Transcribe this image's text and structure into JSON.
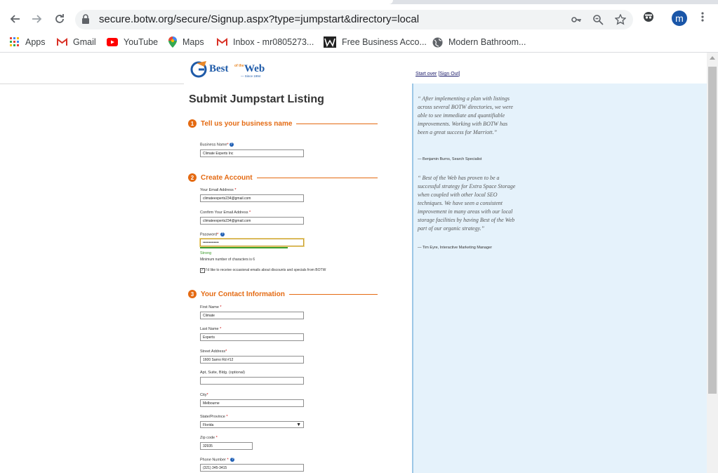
{
  "browser": {
    "url": "secure.botw.org/secure/Signup.aspx?type=jumpstart&directory=local",
    "avatar_letter": "m",
    "bookmarks": [
      {
        "label": "Apps",
        "icon": "apps-grid-icon"
      },
      {
        "label": "Gmail",
        "icon": "gmail-icon"
      },
      {
        "label": "YouTube",
        "icon": "youtube-icon"
      },
      {
        "label": "Maps",
        "icon": "maps-pin-icon"
      },
      {
        "label": "Inbox - mr0805273...",
        "icon": "gmail-icon"
      },
      {
        "label": "Free Business Acco...",
        "icon": "w-logo-icon"
      },
      {
        "label": "Modern Bathroom...",
        "icon": "globe-icon"
      }
    ]
  },
  "header": {
    "logo_text": "Best Web",
    "logo_small": "of the",
    "logo_since": "— Since 1994",
    "start_over": "Start over",
    "sign_out": "Sign Out"
  },
  "form": {
    "title": "Submit Jumpstart Listing",
    "sections": [
      {
        "num": "1",
        "title": "Tell us your business name"
      },
      {
        "num": "2",
        "title": "Create Account"
      },
      {
        "num": "3",
        "title": "Your Contact Information"
      }
    ],
    "business_name": {
      "label": "Business Name",
      "value": "Climate Experts Inc"
    },
    "email": {
      "label": "Your Email Address",
      "value": "climateexperts234@gmail.com"
    },
    "confirm_email": {
      "label": "Confirm Your Email Address",
      "value": "climateexperts234@gmail.com"
    },
    "password": {
      "label": "Password",
      "value": "•••••••••••••",
      "strength": "Strong",
      "hint": "Minimum number of characters is 6"
    },
    "newsletter": {
      "label": "I'd like to receive occasional emails about discounts and specials from BOTW",
      "checked": "✓"
    },
    "first_name": {
      "label": "First Name",
      "value": "Climate"
    },
    "last_name": {
      "label": "Last Name",
      "value": "Experts"
    },
    "street": {
      "label": "Street Address",
      "value": "1600 Sarno Rd #12"
    },
    "apt": {
      "label": "Apt, Suite, Bldg. (optional)",
      "value": ""
    },
    "city": {
      "label": "City",
      "value": "Melbourne"
    },
    "state": {
      "label": "State/Province",
      "value": "Florida"
    },
    "zip": {
      "label": "Zip code",
      "value": "32935"
    },
    "phone": {
      "label": "Phone Number",
      "value": "(321) 345-3415"
    },
    "required_mark": "*"
  },
  "sidebar": {
    "quotes": [
      {
        "text": "“ After implementing a plan with listings across several BOTW directories, we were able to see immediate and quantifiable improvements. Working with BOTW has been a great success for Marriott.”",
        "author": "— Benjamin Burns, Search Specialist"
      },
      {
        "text": "“ Best of the Web has proven to be a successful strategy for Extra Space Storage when coupled with other local SEO techniques. We have seen a consistent improvement in many areas with our local storage facilities by having Best of the Web part of our organic strategy.”",
        "author": "— Tim Eyre, Interactive Marketing Manager"
      }
    ]
  }
}
